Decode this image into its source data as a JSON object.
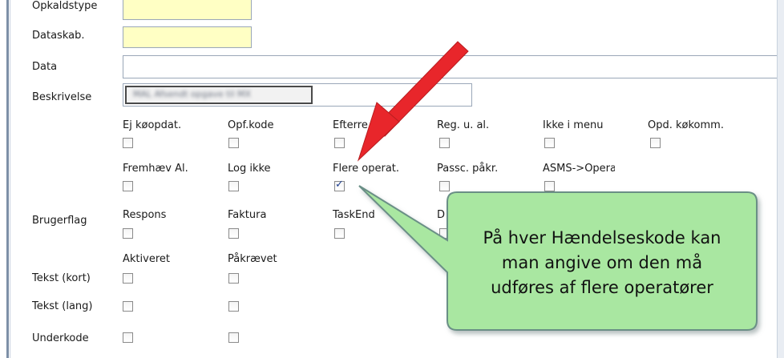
{
  "form": {
    "rows": {
      "opkaldstype": "Opkaldstype",
      "dataskab": "Dataskab.",
      "data": "Data",
      "beskrivelse": "Beskrivelse",
      "brugerflag": "Brugerflag",
      "tekst_kort": "Tekst (kort)",
      "tekst_lang": "Tekst (lang)",
      "underkode": "Underkode"
    },
    "beskrivelse_value": "MAL Afsendt opgave til MX",
    "flags_row1": [
      "Ej køopdat.",
      "Opf.kode",
      "Efterre",
      "Reg. u. al.",
      "Ikke i menu",
      "Opd. køkomm."
    ],
    "flags_row2": [
      "Fremhæv Al.",
      "Log ikke",
      "Flere operat.",
      "Passc. påkr.",
      "ASMS->Operat"
    ],
    "flags_row3": [
      "Respons",
      "Faktura",
      "TaskEnd",
      "D"
    ],
    "flags_row4": [
      "Aktiveret",
      "Påkrævet"
    ],
    "checked_flag": "Flere operat."
  },
  "callout": {
    "line1": "På hver Hændelseskode kan",
    "line2": "man angive om den må",
    "line3": "udføres af flere operatører"
  },
  "colors": {
    "callout_fill": "#a9e7a1",
    "arrow": "#e8262b",
    "yellow_field": "#ffffc4"
  }
}
